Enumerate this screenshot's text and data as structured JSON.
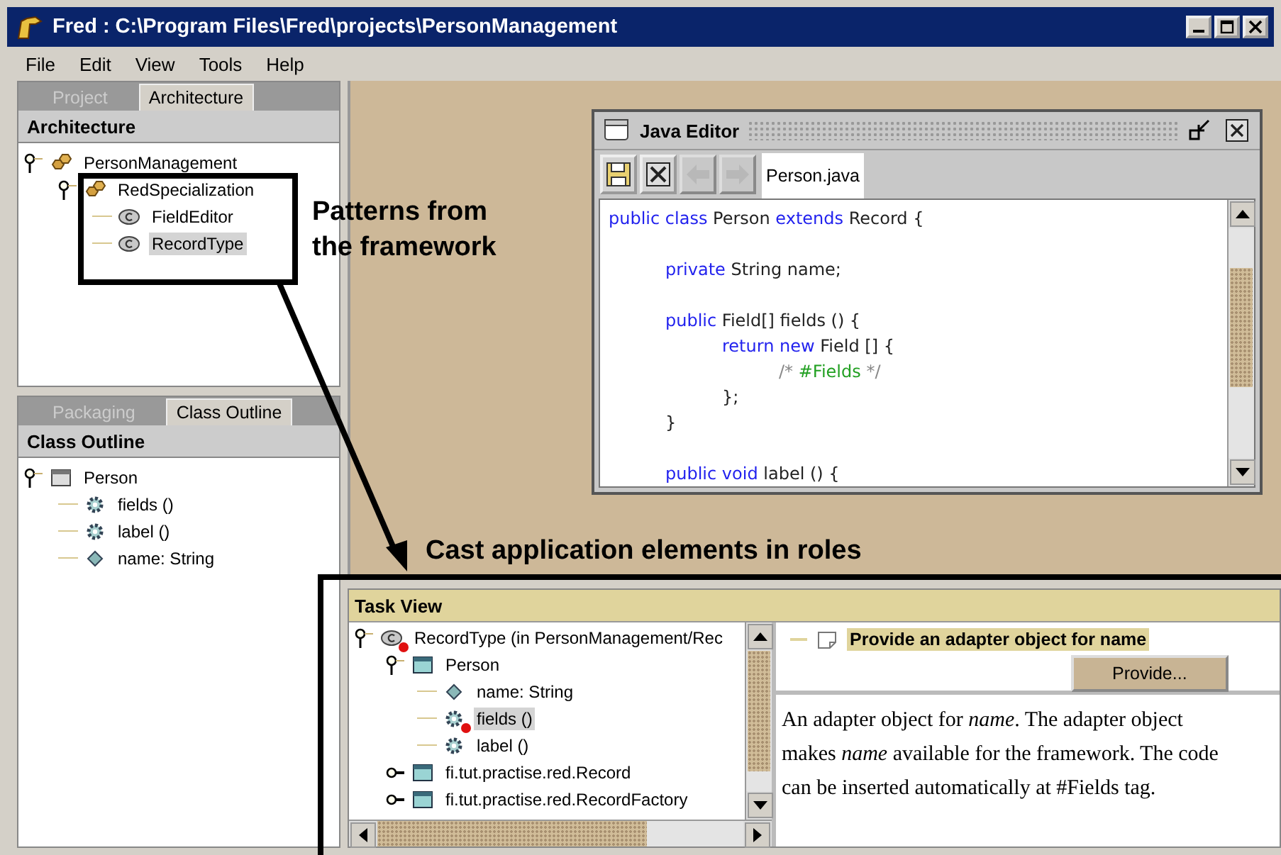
{
  "window": {
    "title": "Fred : C:\\Program Files\\Fred\\projects\\PersonManagement"
  },
  "menu": [
    "File",
    "Edit",
    "View",
    "Tools",
    "Help"
  ],
  "architecture_panel": {
    "tabs": [
      {
        "label": "Project",
        "selected": false
      },
      {
        "label": "Architecture",
        "selected": true
      }
    ],
    "header": "Architecture",
    "tree": [
      {
        "label": "PersonManagement",
        "kind": "package",
        "expanded": true,
        "selected": false,
        "children": [
          {
            "label": "RedSpecialization",
            "kind": "package",
            "expanded": true,
            "selected": false,
            "children": [
              {
                "label": "FieldEditor",
                "kind": "class",
                "selected": false
              },
              {
                "label": "RecordType",
                "kind": "class",
                "selected": true
              }
            ]
          }
        ]
      }
    ]
  },
  "outline_panel": {
    "tabs": [
      {
        "label": "Packaging",
        "selected": false
      },
      {
        "label": "Class Outline",
        "selected": true
      }
    ],
    "header": "Class Outline",
    "tree": [
      {
        "label": "Person",
        "kind": "window",
        "expanded": true,
        "selected": false,
        "children": [
          {
            "label": "fields ()",
            "kind": "method",
            "selected": false
          },
          {
            "label": "label ()",
            "kind": "method",
            "selected": false
          },
          {
            "label": "name: String",
            "kind": "field",
            "selected": false
          }
        ]
      }
    ]
  },
  "editor": {
    "title": "Java Editor",
    "toolbar": [
      {
        "kind": "save",
        "disabled": false
      },
      {
        "kind": "close",
        "disabled": false
      },
      {
        "kind": "back",
        "disabled": true
      },
      {
        "kind": "forward",
        "disabled": true
      }
    ],
    "tab": "Person.java",
    "lines": [
      {
        "kind": "code",
        "tokens": [
          {
            "kind": "kw",
            "text": "public class"
          },
          {
            "kind": "plain",
            "text": " Person "
          },
          {
            "kind": "kw",
            "text": "extends"
          },
          {
            "kind": "plain",
            "text": " Record {"
          }
        ]
      },
      {
        "kind": "blank"
      },
      {
        "kind": "code",
        "tokens": [
          {
            "kind": "kw",
            "text": "\tprivate"
          },
          {
            "kind": "plain",
            "text": " String name;"
          }
        ]
      },
      {
        "kind": "blank"
      },
      {
        "kind": "code",
        "tokens": [
          {
            "kind": "kw",
            "text": "\tpublic"
          },
          {
            "kind": "plain",
            "text": " Field[] fields () {"
          }
        ]
      },
      {
        "kind": "code",
        "tokens": [
          {
            "kind": "kw",
            "text": "\t\treturn new"
          },
          {
            "kind": "plain",
            "text": " Field [] {"
          }
        ]
      },
      {
        "kind": "code",
        "tokens": [
          {
            "kind": "comment",
            "text": "\t\t\t/* "
          },
          {
            "kind": "tag",
            "text": "#Fields"
          },
          {
            "kind": "comment",
            "text": " */"
          }
        ]
      },
      {
        "kind": "code",
        "tokens": [
          {
            "kind": "plain",
            "text": "\t\t};"
          }
        ]
      },
      {
        "kind": "code",
        "tokens": [
          {
            "kind": "plain",
            "text": "\t}"
          }
        ]
      },
      {
        "kind": "blank"
      },
      {
        "kind": "code",
        "tokens": [
          {
            "kind": "kw",
            "text": "\tpublic void"
          },
          {
            "kind": "plain",
            "text": " label () {"
          }
        ]
      }
    ]
  },
  "task_view": {
    "header": "Task View",
    "tree": [
      {
        "label": "RecordType (in PersonManagement/Rec",
        "kind": "class",
        "flagged": true,
        "expanded": true,
        "selected": false,
        "children": [
          {
            "label": "Person",
            "kind": "type",
            "flagged": false,
            "expanded": true,
            "selected": false,
            "children": [
              {
                "label": "name: String",
                "kind": "field",
                "flagged": false,
                "selected": false
              },
              {
                "label": "fields ()",
                "kind": "method",
                "flagged": true,
                "selected": true
              },
              {
                "label": "label ()",
                "kind": "method",
                "flagged": false,
                "selected": false
              }
            ]
          },
          {
            "label": "fi.tut.practise.red.Record",
            "kind": "type",
            "flagged": false,
            "expanded": false,
            "selected": false
          },
          {
            "label": "fi.tut.practise.red.RecordFactory",
            "kind": "type",
            "flagged": false,
            "expanded": false,
            "selected": false
          }
        ]
      }
    ],
    "task": {
      "label": "Provide an adapter object for name",
      "selected": true
    },
    "popup": "Provide...",
    "description": "An adapter object for *name*. The adapter object makes *name* available for the framework. The code can be inserted automatically at #Fields tag."
  },
  "annotations": [
    "Patterns from the framework",
    "Cast application elements in roles"
  ]
}
